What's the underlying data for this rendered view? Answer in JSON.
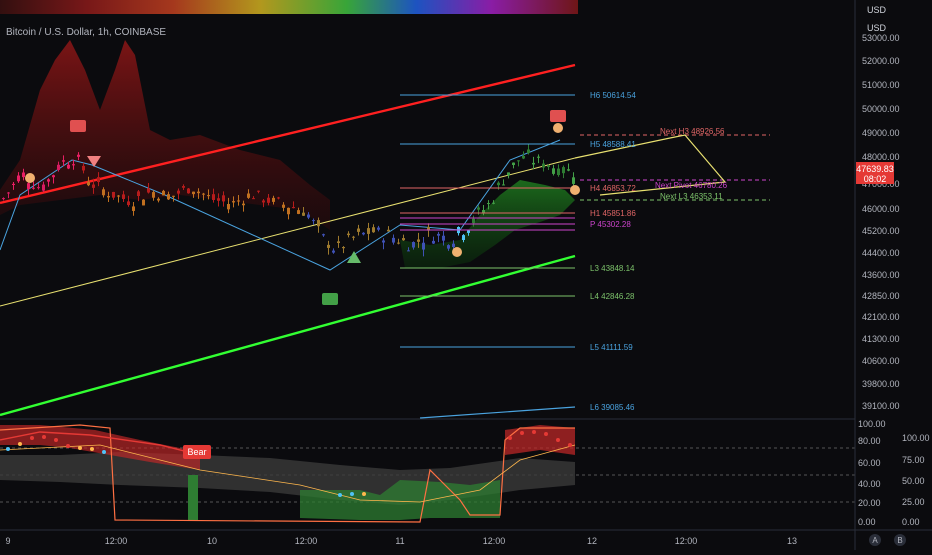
{
  "header": {
    "symbol_title": "Bitcoin / U.S. Dollar, 1h, COINBASE",
    "currency_top": "USD",
    "currency_main": "USD"
  },
  "price_scale": {
    "ticks": [
      "53000.00",
      "52000.00",
      "51000.00",
      "50000.00",
      "49000.00",
      "48000.00",
      "47000.00",
      "46000.00",
      "45200.00",
      "44400.00",
      "43600.00",
      "42850.00",
      "42100.00",
      "41300.00",
      "40600.00",
      "39800.00",
      "39100.00"
    ],
    "last_price": "47639.83",
    "countdown": "08:02"
  },
  "time_axis": {
    "ticks": [
      "9",
      "12:00",
      "10",
      "12:00",
      "11",
      "12:00",
      "12",
      "12:00",
      "13"
    ]
  },
  "oscillator": {
    "left_ticks": [
      "100.00",
      "80.00",
      "60.00",
      "40.00",
      "20.00",
      "0.00"
    ],
    "right_ticks": [
      "100.00",
      "75.00",
      "50.00",
      "25.00",
      "0.00"
    ],
    "bear_label": "Bear"
  },
  "pivots": [
    {
      "label": "H6 50614.54",
      "color": "#4aa3df"
    },
    {
      "label": "H5 48588.41",
      "color": "#4aa3df"
    },
    {
      "label": "H4 46853.72",
      "color": "#e06666"
    },
    {
      "label": "H1 45851.86",
      "color": "#e06666"
    },
    {
      "label": "P 45302.28",
      "color": "#cc44cc"
    },
    {
      "label": "L3 43848.14",
      "color": "#7dc36b"
    },
    {
      "label": "L4 42846.28",
      "color": "#7dc36b"
    },
    {
      "label": "L5 41111.59",
      "color": "#4aa3df"
    },
    {
      "label": "L6 39085.46",
      "color": "#4aa3df"
    }
  ],
  "next_pivots": {
    "h3": "Next H3 48926.56",
    "pivot": "Next Pivot 46780.26",
    "l3": "Next L3 46353.11"
  },
  "footer_buttons": {
    "a": "A",
    "b": "B"
  },
  "colors": {
    "up": "#2e7d32",
    "down": "#b71c1c",
    "last_price_bg": "#e53935",
    "red_line": "#ff2020",
    "green_line": "#32ff32",
    "yellow_line": "#e8e070"
  },
  "chart_data": {
    "type": "line",
    "title": "Bitcoin / U.S. Dollar, 1h, COINBASE",
    "xlabel": "",
    "ylabel": "",
    "x": [
      "9",
      "12:00",
      "10",
      "12:00",
      "11",
      "12:00",
      "12"
    ],
    "series": [
      {
        "name": "",
        "values": [
          47500,
          47900,
          46500,
          45800,
          45000,
          47500,
          47640
        ]
      }
    ],
    "ylim": [
      39000,
      53500
    ],
    "grid": false
  }
}
